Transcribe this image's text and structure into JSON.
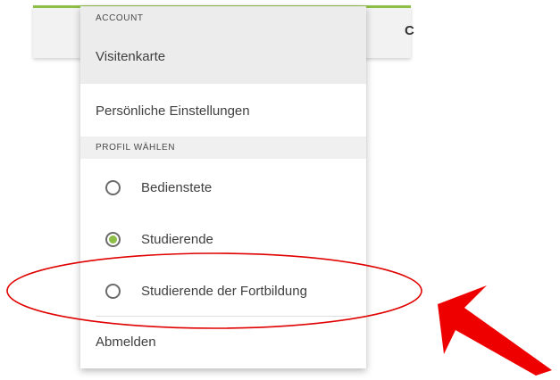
{
  "header": {
    "accent_color": "#8dbe45",
    "fragment_text": "C"
  },
  "menu": {
    "account_section": "ACCOUNT",
    "items": {
      "visitenkarte": "Visitenkarte",
      "settings": "Persönliche Einstellungen",
      "logout": "Abmelden"
    },
    "profile_section": "PROFIL WÄHLEN",
    "profiles": [
      {
        "label": "Bedienstete",
        "selected": false
      },
      {
        "label": "Studierende",
        "selected": true
      },
      {
        "label": "Studierende der Fortbildung",
        "selected": false
      }
    ],
    "selected_dot_color": "#8dbe45"
  },
  "annotation": {
    "ellipse_color": "#e00000",
    "arrow_color": "#ee0000"
  }
}
